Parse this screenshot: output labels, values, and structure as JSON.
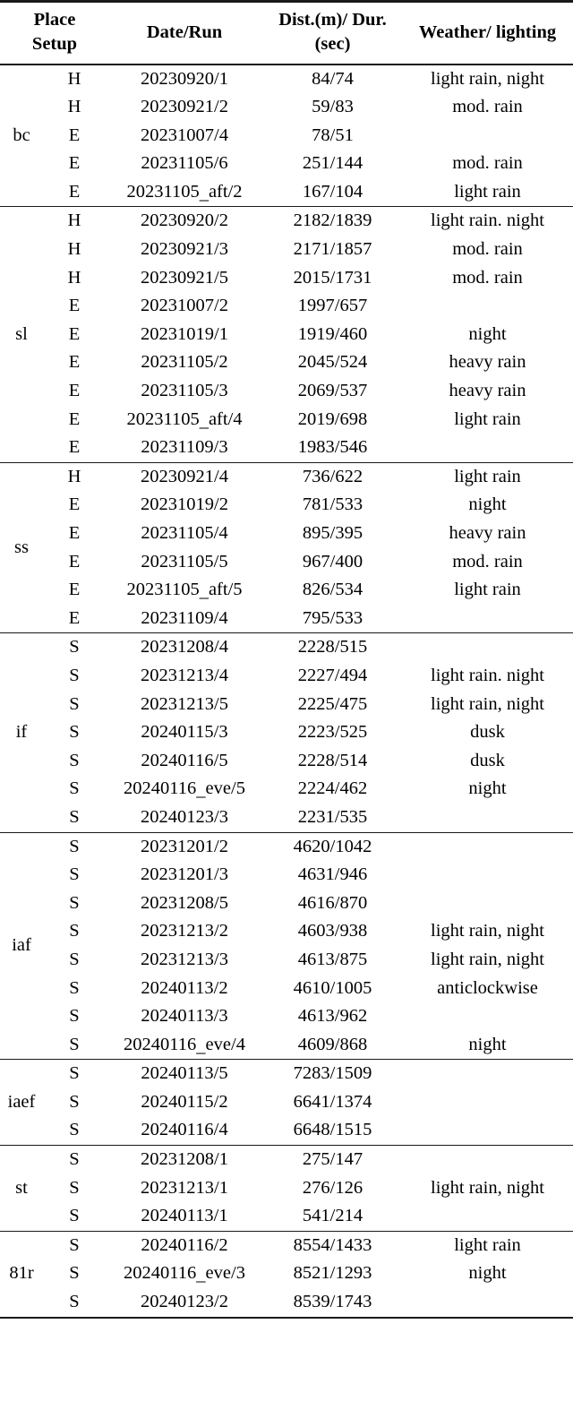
{
  "table": {
    "headers": {
      "place": "Place",
      "setup": "Setup",
      "date_run": "Date/Run",
      "dist_line1": "Dist.(m)/",
      "dist_line2": "Dur.(sec)",
      "weather_line1": "Weather/",
      "weather_line2": "lighting"
    },
    "sections": [
      {
        "place": "bc",
        "rows": [
          {
            "setup": "H",
            "date_run": "20230920/1",
            "dist_dur": "84/74",
            "weather": "light rain, night"
          },
          {
            "setup": "H",
            "date_run": "20230921/2",
            "dist_dur": "59/83",
            "weather": "mod. rain"
          },
          {
            "setup": "E",
            "date_run": "20231007/4",
            "dist_dur": "78/51",
            "weather": ""
          },
          {
            "setup": "E",
            "date_run": "20231105/6",
            "dist_dur": "251/144",
            "weather": "mod. rain"
          },
          {
            "setup": "E",
            "date_run": "20231105_aft/2",
            "dist_dur": "167/104",
            "weather": "light rain"
          }
        ]
      },
      {
        "place": "sl",
        "rows": [
          {
            "setup": "H",
            "date_run": "20230920/2",
            "dist_dur": "2182/1839",
            "weather": "light rain. night"
          },
          {
            "setup": "H",
            "date_run": "20230921/3",
            "dist_dur": "2171/1857",
            "weather": "mod. rain"
          },
          {
            "setup": "H",
            "date_run": "20230921/5",
            "dist_dur": "2015/1731",
            "weather": "mod. rain"
          },
          {
            "setup": "E",
            "date_run": "20231007/2",
            "dist_dur": "1997/657",
            "weather": ""
          },
          {
            "setup": "E",
            "date_run": "20231019/1",
            "dist_dur": "1919/460",
            "weather": "night"
          },
          {
            "setup": "E",
            "date_run": "20231105/2",
            "dist_dur": "2045/524",
            "weather": "heavy rain"
          },
          {
            "setup": "E",
            "date_run": "20231105/3",
            "dist_dur": "2069/537",
            "weather": "heavy rain"
          },
          {
            "setup": "E",
            "date_run": "20231105_aft/4",
            "dist_dur": "2019/698",
            "weather": "light rain"
          },
          {
            "setup": "E",
            "date_run": "20231109/3",
            "dist_dur": "1983/546",
            "weather": ""
          }
        ]
      },
      {
        "place": "ss",
        "rows": [
          {
            "setup": "H",
            "date_run": "20230921/4",
            "dist_dur": "736/622",
            "weather": "light rain"
          },
          {
            "setup": "E",
            "date_run": "20231019/2",
            "dist_dur": "781/533",
            "weather": "night"
          },
          {
            "setup": "E",
            "date_run": "20231105/4",
            "dist_dur": "895/395",
            "weather": "heavy rain"
          },
          {
            "setup": "E",
            "date_run": "20231105/5",
            "dist_dur": "967/400",
            "weather": "mod. rain"
          },
          {
            "setup": "E",
            "date_run": "20231105_aft/5",
            "dist_dur": "826/534",
            "weather": "light rain"
          },
          {
            "setup": "E",
            "date_run": "20231109/4",
            "dist_dur": "795/533",
            "weather": ""
          }
        ]
      },
      {
        "place": "if",
        "rows": [
          {
            "setup": "S",
            "date_run": "20231208/4",
            "dist_dur": "2228/515",
            "weather": ""
          },
          {
            "setup": "S",
            "date_run": "20231213/4",
            "dist_dur": "2227/494",
            "weather": "light rain. night"
          },
          {
            "setup": "S",
            "date_run": "20231213/5",
            "dist_dur": "2225/475",
            "weather": "light rain, night"
          },
          {
            "setup": "S",
            "date_run": "20240115/3",
            "dist_dur": "2223/525",
            "weather": "dusk"
          },
          {
            "setup": "S",
            "date_run": "20240116/5",
            "dist_dur": "2228/514",
            "weather": "dusk"
          },
          {
            "setup": "S",
            "date_run": "20240116_eve/5",
            "dist_dur": "2224/462",
            "weather": "night"
          },
          {
            "setup": "S",
            "date_run": "20240123/3",
            "dist_dur": "2231/535",
            "weather": ""
          }
        ]
      },
      {
        "place": "iaf",
        "rows": [
          {
            "setup": "S",
            "date_run": "20231201/2",
            "dist_dur": "4620/1042",
            "weather": ""
          },
          {
            "setup": "S",
            "date_run": "20231201/3",
            "dist_dur": "4631/946",
            "weather": ""
          },
          {
            "setup": "S",
            "date_run": "20231208/5",
            "dist_dur": "4616/870",
            "weather": ""
          },
          {
            "setup": "S",
            "date_run": "20231213/2",
            "dist_dur": "4603/938",
            "weather": "light rain, night"
          },
          {
            "setup": "S",
            "date_run": "20231213/3",
            "dist_dur": "4613/875",
            "weather": "light rain, night"
          },
          {
            "setup": "S",
            "date_run": "20240113/2",
            "dist_dur": "4610/1005",
            "weather": "anticlockwise"
          },
          {
            "setup": "S",
            "date_run": "20240113/3",
            "dist_dur": "4613/962",
            "weather": ""
          },
          {
            "setup": "S",
            "date_run": "20240116_eve/4",
            "dist_dur": "4609/868",
            "weather": "night"
          }
        ]
      },
      {
        "place": "iaef",
        "rows": [
          {
            "setup": "S",
            "date_run": "20240113/5",
            "dist_dur": "7283/1509",
            "weather": ""
          },
          {
            "setup": "S",
            "date_run": "20240115/2",
            "dist_dur": "6641/1374",
            "weather": ""
          },
          {
            "setup": "S",
            "date_run": "20240116/4",
            "dist_dur": "6648/1515",
            "weather": ""
          }
        ]
      },
      {
        "place": "st",
        "rows": [
          {
            "setup": "S",
            "date_run": "20231208/1",
            "dist_dur": "275/147",
            "weather": ""
          },
          {
            "setup": "S",
            "date_run": "20231213/1",
            "dist_dur": "276/126",
            "weather": "light rain, night"
          },
          {
            "setup": "S",
            "date_run": "20240113/1",
            "dist_dur": "541/214",
            "weather": ""
          }
        ]
      },
      {
        "place": "81r",
        "rows": [
          {
            "setup": "S",
            "date_run": "20240116/2",
            "dist_dur": "8554/1433",
            "weather": "light rain"
          },
          {
            "setup": "S",
            "date_run": "20240116_eve/3",
            "dist_dur": "8521/1293",
            "weather": "night"
          },
          {
            "setup": "S",
            "date_run": "20240123/2",
            "dist_dur": "8539/1743",
            "weather": ""
          }
        ]
      }
    ]
  }
}
